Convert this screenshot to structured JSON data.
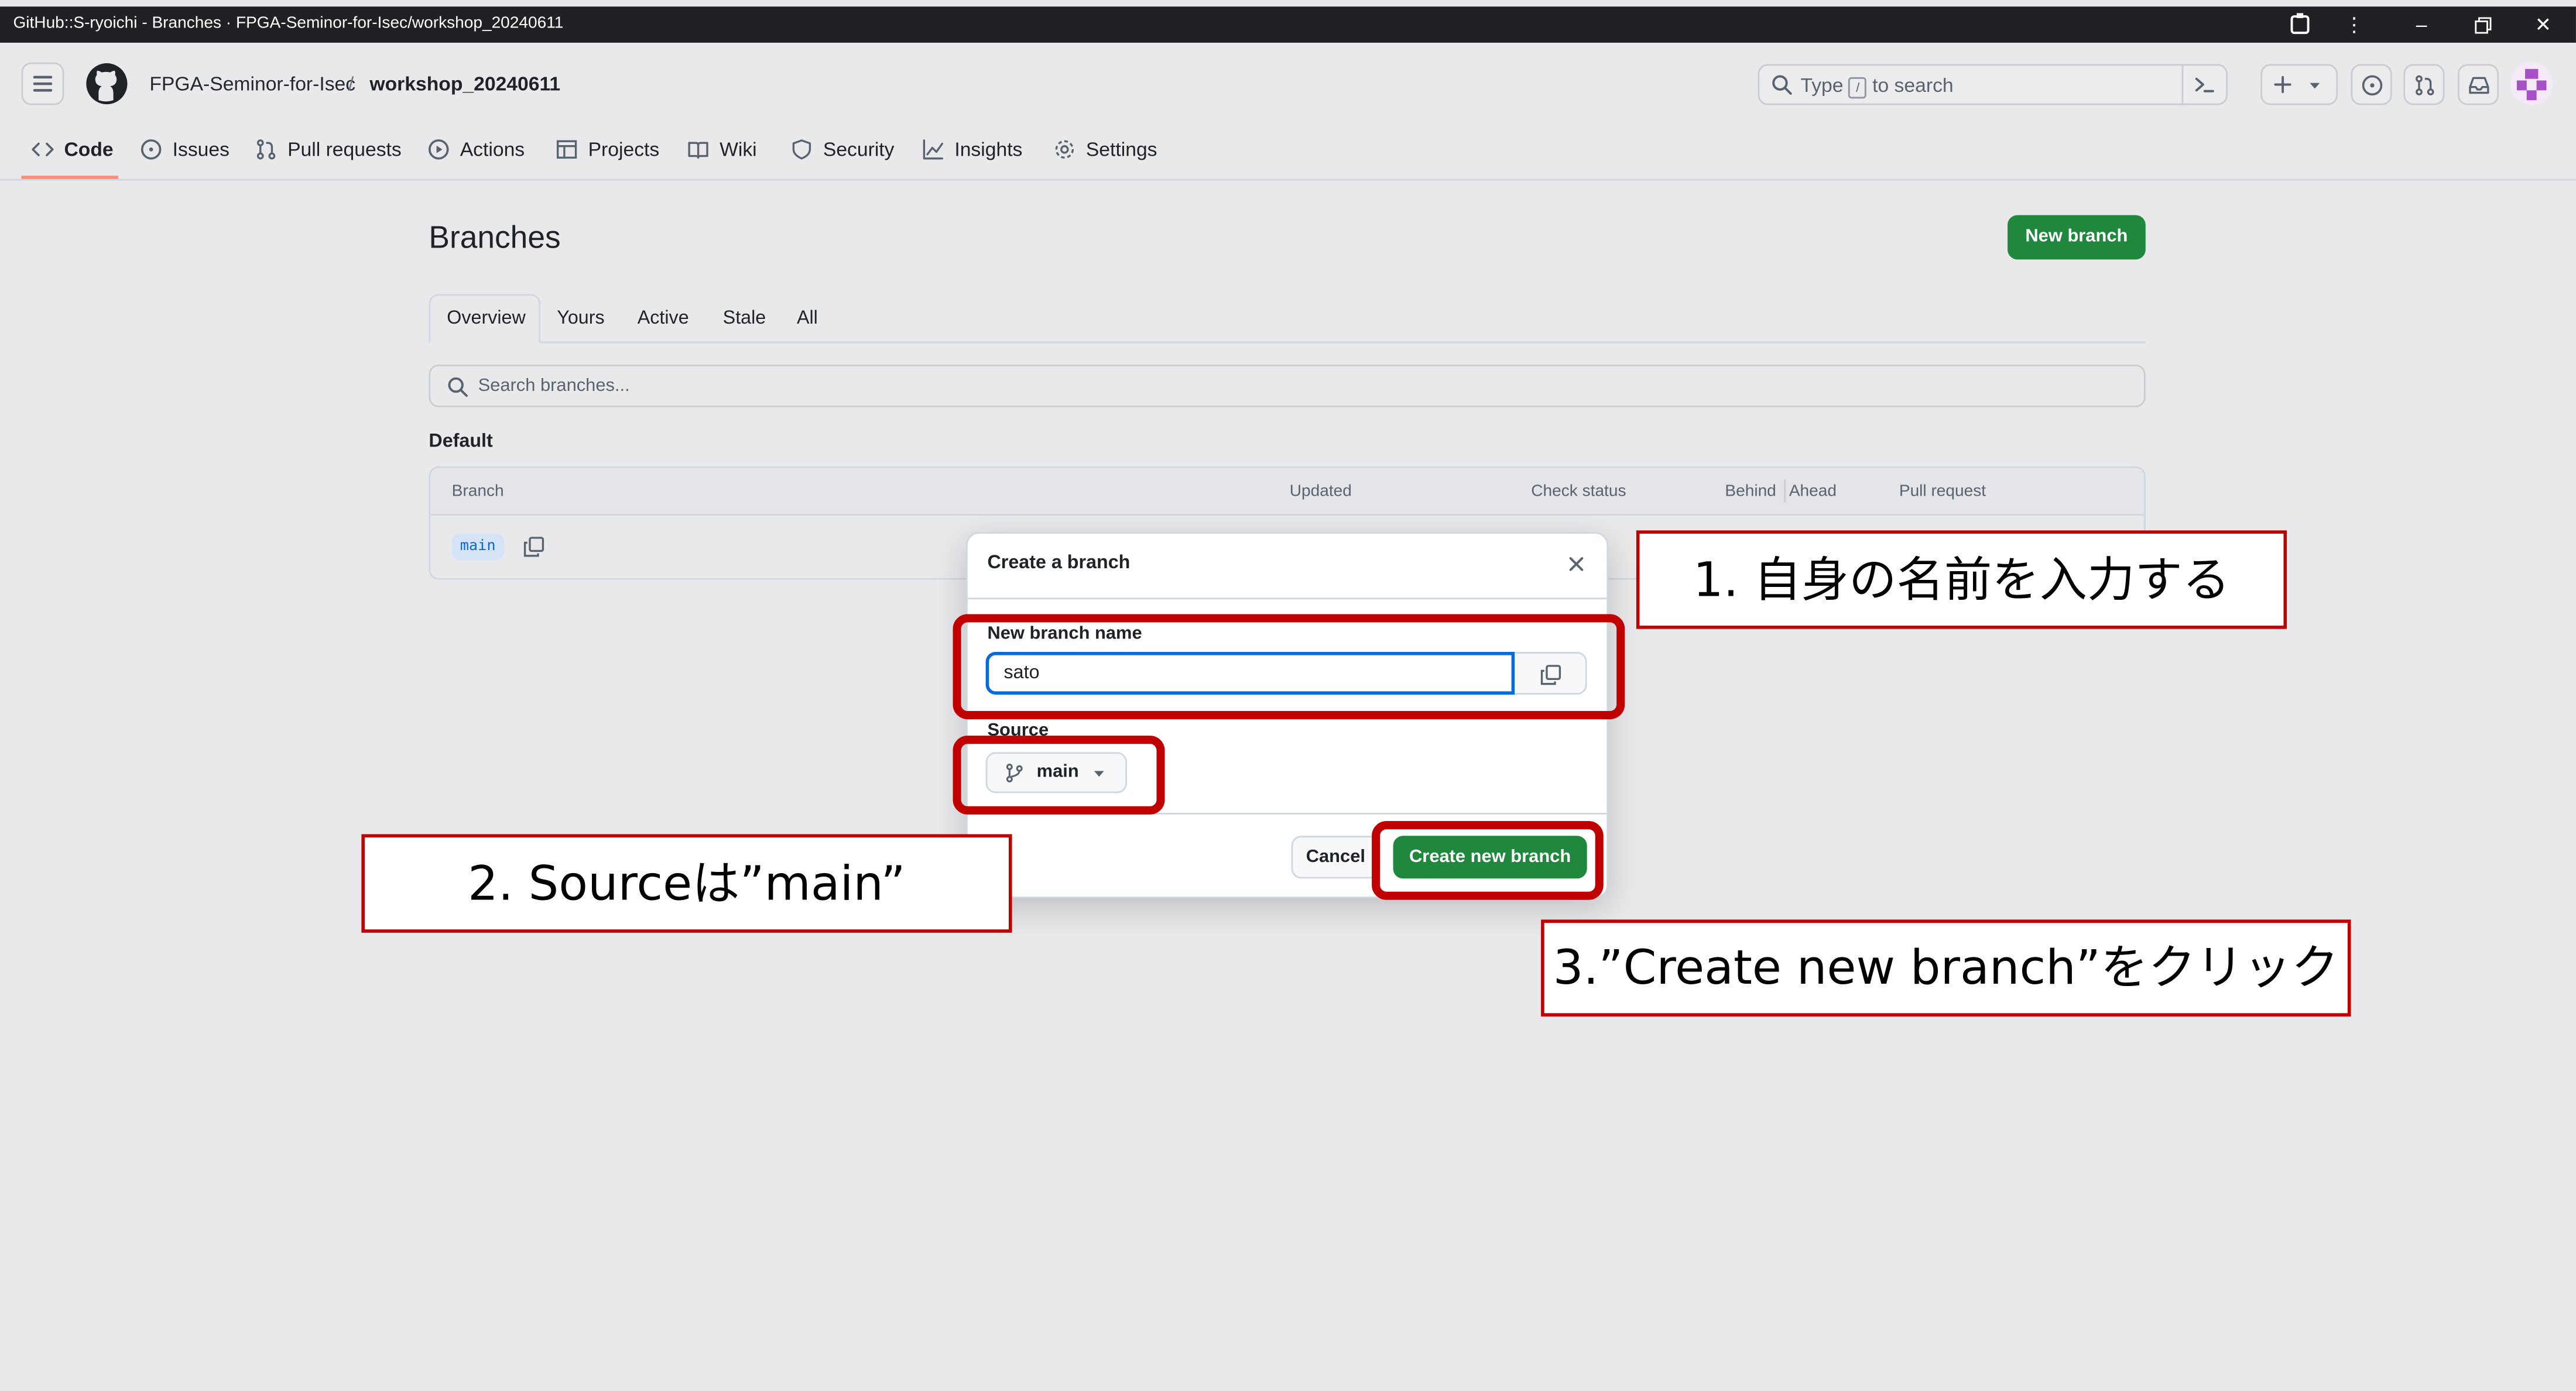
{
  "window": {
    "title": "GitHub::S-ryoichi - Branches · FPGA-Seminor-for-Isec/workshop_20240611"
  },
  "header": {
    "owner": "FPGA-Seminor-for-Isec",
    "separator": "/",
    "repo": "workshop_20240611",
    "search_prefix": "Type",
    "search_key": "/",
    "search_suffix": "to search"
  },
  "repo_nav": [
    {
      "label": "Code",
      "icon": "code-icon"
    },
    {
      "label": "Issues",
      "icon": "issue-icon"
    },
    {
      "label": "Pull requests",
      "icon": "pull-request-icon"
    },
    {
      "label": "Actions",
      "icon": "play-icon"
    },
    {
      "label": "Projects",
      "icon": "table-icon"
    },
    {
      "label": "Wiki",
      "icon": "book-icon"
    },
    {
      "label": "Security",
      "icon": "shield-icon"
    },
    {
      "label": "Insights",
      "icon": "graph-icon"
    },
    {
      "label": "Settings",
      "icon": "gear-icon"
    }
  ],
  "branches": {
    "title": "Branches",
    "new_branch_label": "New branch",
    "tabs": [
      "Overview",
      "Yours",
      "Active",
      "Stale",
      "All"
    ],
    "search_placeholder": "Search branches...",
    "section_label": "Default",
    "columns": {
      "branch": "Branch",
      "updated": "Updated",
      "check_status": "Check status",
      "behind": "Behind",
      "ahead": "Ahead",
      "pull_request": "Pull request"
    },
    "rows": [
      {
        "name": "main"
      }
    ]
  },
  "dialog": {
    "title": "Create a branch",
    "name_label": "New branch name",
    "name_value": "sato",
    "source_label": "Source",
    "source_value": "main",
    "cancel_label": "Cancel",
    "create_label": "Create new branch"
  },
  "annotations": {
    "step1": "1. 自身の名前を入力する",
    "step2": "2. Sourceは”main”",
    "step3": "3.”Create new branch”をクリック",
    "color": "#c00000"
  },
  "colors": {
    "primary_button": "#1f883d",
    "focus": "#0969da",
    "nav_underline": "#fd8c73"
  }
}
